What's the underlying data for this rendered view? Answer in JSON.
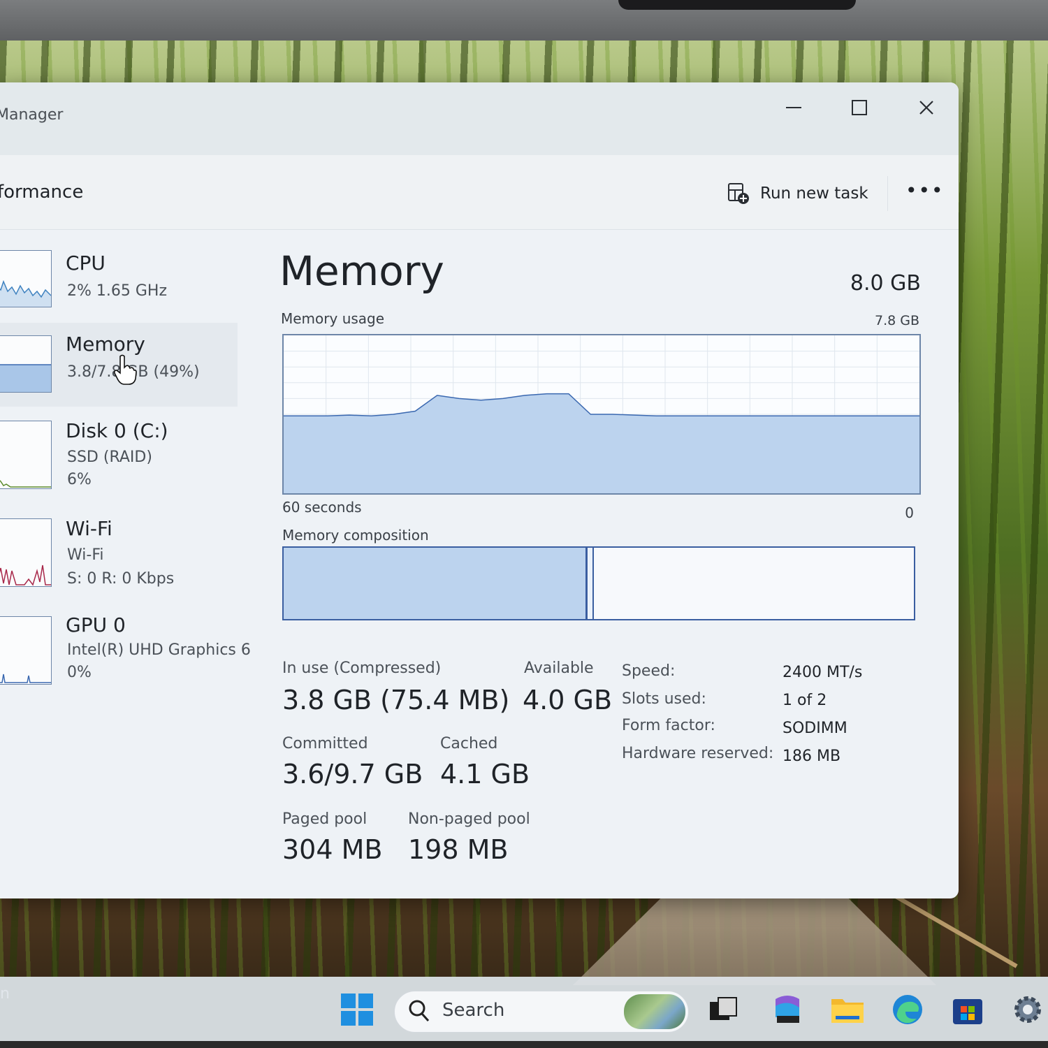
{
  "window": {
    "title": "Manager",
    "page_title": "formance",
    "run_new_task": "Run new task",
    "more": "•••"
  },
  "sidebar": {
    "items": [
      {
        "name": "CPU",
        "line1": "2%  1.65 GHz",
        "line2": ""
      },
      {
        "name": "Memory",
        "line1": "3.8/7.8 GB (49%)",
        "line2": ""
      },
      {
        "name": "Disk 0 (C:)",
        "line1": "SSD (RAID)",
        "line2": "6%"
      },
      {
        "name": "Wi-Fi",
        "line1": "Wi-Fi",
        "line2": "S: 0  R: 0 Kbps"
      },
      {
        "name": "GPU 0",
        "line1": "Intel(R) UHD Graphics 6",
        "line2": "0%"
      }
    ],
    "selected": "Memory"
  },
  "main": {
    "title": "Memory",
    "total": "8.0 GB",
    "usage_label": "Memory usage",
    "usage_max": "7.8 GB",
    "usage_time": "60 seconds",
    "usage_min": "0",
    "composition_label": "Memory composition",
    "in_use_level": 0.49,
    "usage_history": [
      0.49,
      0.49,
      0.49,
      0.495,
      0.49,
      0.5,
      0.52,
      0.62,
      0.6,
      0.59,
      0.6,
      0.62,
      0.63,
      0.63,
      0.5,
      0.5,
      0.495,
      0.49,
      0.49,
      0.49,
      0.49,
      0.49,
      0.49,
      0.49,
      0.49,
      0.49,
      0.49,
      0.49,
      0.49,
      0.49
    ]
  },
  "stats": {
    "in_use_label": "In use (Compressed)",
    "in_use_value": "3.8 GB (75.4 MB)",
    "available_label": "Available",
    "available_value": "4.0 GB",
    "committed_label": "Committed",
    "committed_value": "3.6/9.7 GB",
    "cached_label": "Cached",
    "cached_value": "4.1 GB",
    "paged_label": "Paged pool",
    "paged_value": "304 MB",
    "nonpaged_label": "Non-paged pool",
    "nonpaged_value": "198 MB"
  },
  "specs": {
    "speed_label": "Speed:",
    "speed_value": "2400 MT/s",
    "slots_label": "Slots used:",
    "slots_value": "1 of 2",
    "form_label": "Form factor:",
    "form_value": "SODIMM",
    "reserved_label": "Hardware reserved:",
    "reserved_value": "186 MB"
  },
  "taskbar": {
    "search_text": "Search",
    "left_text": "n"
  },
  "colors": {
    "graph_fill": "#bcd3ee",
    "graph_line": "#3a68b0",
    "grid": "#dfe6ee",
    "cpu_line": "#3f82c0",
    "wifi_line": "#a8284a",
    "disk_line": "#5a8a2a"
  }
}
